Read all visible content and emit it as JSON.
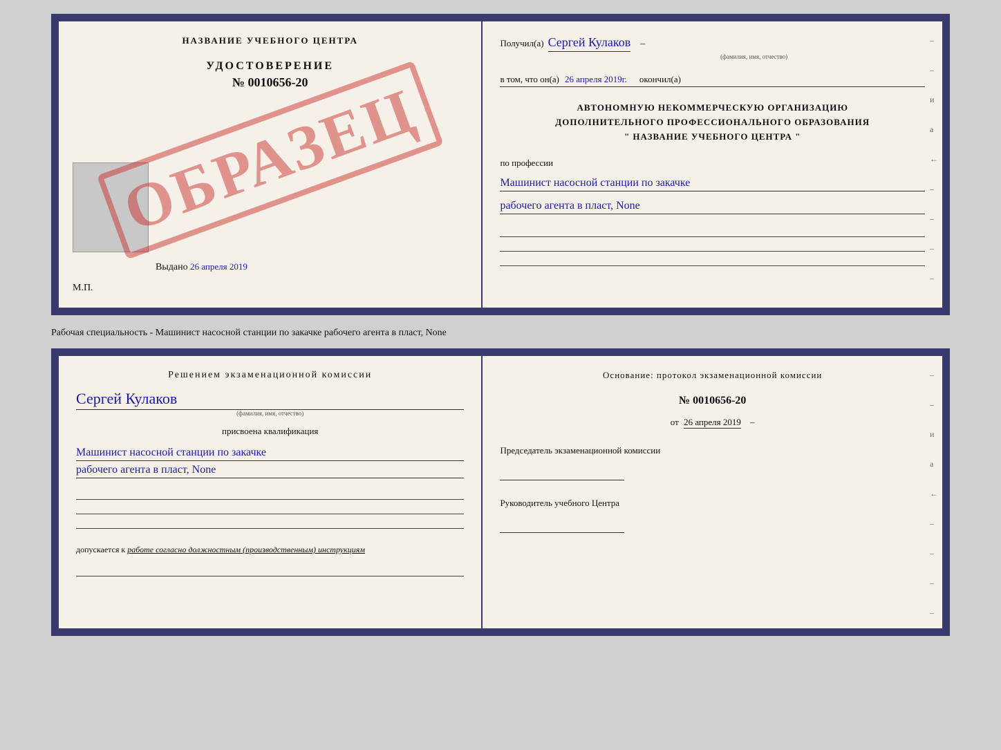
{
  "top_doc": {
    "left": {
      "center_title": "НАЗВАНИЕ УЧЕБНОГО ЦЕНТРА",
      "stamp_text": "ОБРАЗЕЦ",
      "udostoverenie_label": "УДОСТОВЕРЕНИЕ",
      "number": "№ 0010656-20",
      "vydano_label": "Выдано",
      "vydano_date": "26 апреля 2019",
      "mp_label": "М.П."
    },
    "right": {
      "poluchil_label": "Получил(а)",
      "recipient_name": "Сергей Кулаков",
      "fio_sub": "(фамилия, имя, отчество)",
      "dash": "–",
      "vtom_label": "в том, что он(а)",
      "vtom_date": "26 апреля 2019г.",
      "okonchil_label": "окончил(а)",
      "org_line1": "АВТОНОМНУЮ НЕКОММЕРЧЕСКУЮ ОРГАНИЗАЦИЮ",
      "org_line2": "ДОПОЛНИТЕЛЬНОГО ПРОФЕССИОНАЛЬНОГО ОБРАЗОВАНИЯ",
      "org_line3": "\"  НАЗВАНИЕ УЧЕБНОГО ЦЕНТРА  \"",
      "po_professii": "по профессии",
      "profession1": "Машинист насосной станции по закачке",
      "profession2": "рабочего агента в пласт, None"
    }
  },
  "separator": {
    "text": "Рабочая специальность - Машинист насосной станции по закачке рабочего агента в пласт, None"
  },
  "bottom_doc": {
    "left": {
      "resheniem": "Решением экзаменационной комиссии",
      "fio": "Сергей Кулаков",
      "fio_sub": "(фамилия, имя, отчество)",
      "prisvoena": "присвоена квалификация",
      "profession1": "Машинист насосной станции по закачке",
      "profession2": "рабочего агента в пласт, None",
      "dopuskaetsya": "допускается к",
      "dopuskaetsya_work": "работе согласно должностным (производственным) инструкциям"
    },
    "right": {
      "osnov_label": "Основание: протокол экзаменационной комиссии",
      "protocol_num": "№ 0010656-20",
      "ot_label": "от",
      "ot_date": "26 апреля 2019",
      "predsedatel_label": "Председатель экзаменационной комиссии",
      "rukovoditel_label": "Руководитель учебного Центра"
    }
  },
  "side_markers": [
    "–",
    "–",
    "и",
    "а",
    "←",
    "–",
    "–",
    "–",
    "–"
  ]
}
